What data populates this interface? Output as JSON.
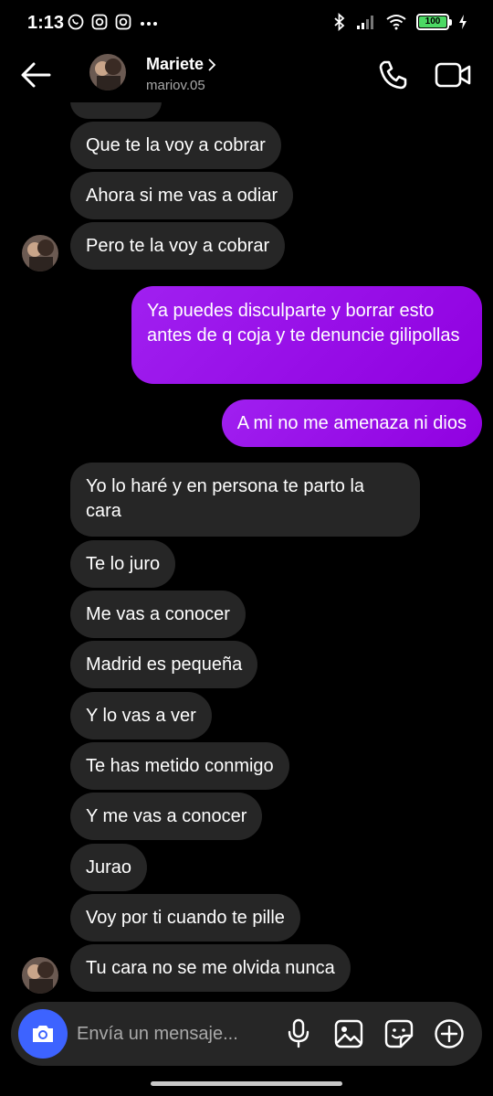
{
  "status": {
    "time": "1:13",
    "battery": "100"
  },
  "header": {
    "name": "Mariete",
    "handle": "mariov.05"
  },
  "messages": [
    {
      "dir": "in",
      "text": "Que te la voy a cobrar"
    },
    {
      "dir": "in",
      "text": "Ahora si me vas a odiar"
    },
    {
      "dir": "in",
      "text": "Pero te la voy a cobrar"
    },
    {
      "dir": "out",
      "text": "Ya puedes disculparte y borrar esto antes de q coja y te denuncie gilipollas"
    },
    {
      "dir": "out",
      "text": "A mi no me amenaza ni dios"
    },
    {
      "dir": "in",
      "text": "Yo lo haré y en persona te parto la cara"
    },
    {
      "dir": "in",
      "text": "Te lo juro"
    },
    {
      "dir": "in",
      "text": "Me vas a conocer"
    },
    {
      "dir": "in",
      "text": "Madrid es pequeña"
    },
    {
      "dir": "in",
      "text": "Y lo vas a ver"
    },
    {
      "dir": "in",
      "text": "Te has metido conmigo"
    },
    {
      "dir": "in",
      "text": "Y me vas a conocer"
    },
    {
      "dir": "in",
      "text": "Jurao"
    },
    {
      "dir": "in",
      "text": "Voy por ti cuando te pille"
    },
    {
      "dir": "in",
      "text": "Tu cara no se me olvida nunca"
    }
  ],
  "composer": {
    "placeholder": "Envía un mensaje..."
  },
  "icons": {
    "back": "arrow-left-icon",
    "call": "phone-icon",
    "video": "video-camera-icon",
    "camera": "camera-icon",
    "mic": "microphone-icon",
    "gallery": "image-icon",
    "sticker": "sticker-icon",
    "add": "plus-circle-icon"
  },
  "colors": {
    "incoming_bubble": "#262626",
    "outgoing_bubble": "#9b10ea",
    "camera_button": "#3d63ff",
    "battery": "#4cd964"
  }
}
